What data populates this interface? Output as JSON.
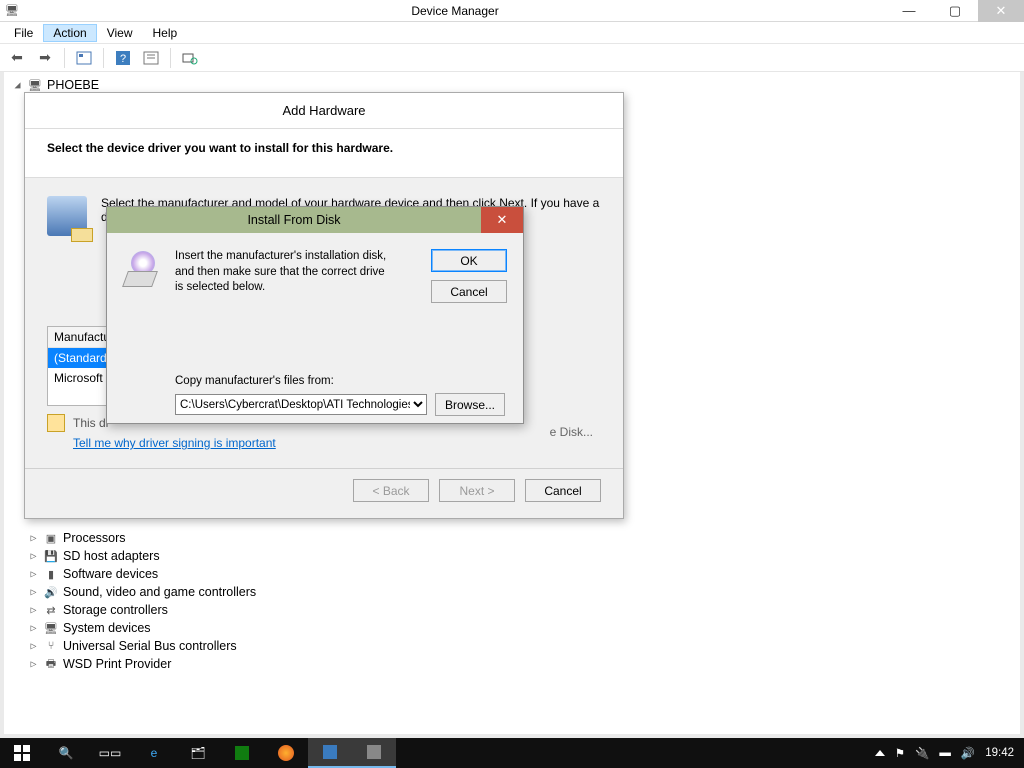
{
  "window": {
    "title": "Device Manager",
    "menus": [
      "File",
      "Action",
      "View",
      "Help"
    ],
    "active_menu_index": 1
  },
  "tree": {
    "root": "PHOEBE",
    "visible_nodes": [
      "Processors",
      "SD host adapters",
      "Software devices",
      "Sound, video and game controllers",
      "Storage controllers",
      "System devices",
      "Universal Serial Bus controllers",
      "WSD Print Provider"
    ]
  },
  "wizard": {
    "title": "Add Hardware",
    "heading": "Select the device driver you want to install for this hardware.",
    "instruction": "Select the manufacturer and model of your hardware device and then click Next. If you have a disk that contains the driver you want to install, click Have Disk.",
    "manufacturer_header": "Manufacturer",
    "manufacturers": [
      "(Standard display types)",
      "Microsoft"
    ],
    "selected_manufacturer_index": 0,
    "signing_text": "This driver is digitally signed.",
    "signing_text_visible_prefix": "This dr",
    "signing_link": "Tell me why driver signing is important",
    "have_disk_visible": "e Disk...",
    "buttons": {
      "back": "< Back",
      "next": "Next >",
      "cancel": "Cancel"
    }
  },
  "install_from_disk": {
    "title": "Install From Disk",
    "message": "Insert the manufacturer's installation disk, and then make sure that the correct drive is selected below.",
    "ok": "OK",
    "cancel": "Cancel",
    "copy_label": "Copy manufacturer's files from:",
    "path": "C:\\Users\\Cybercrat\\Desktop\\ATI Technologies Inc",
    "browse": "Browse..."
  },
  "taskbar": {
    "clock": "19:42"
  }
}
